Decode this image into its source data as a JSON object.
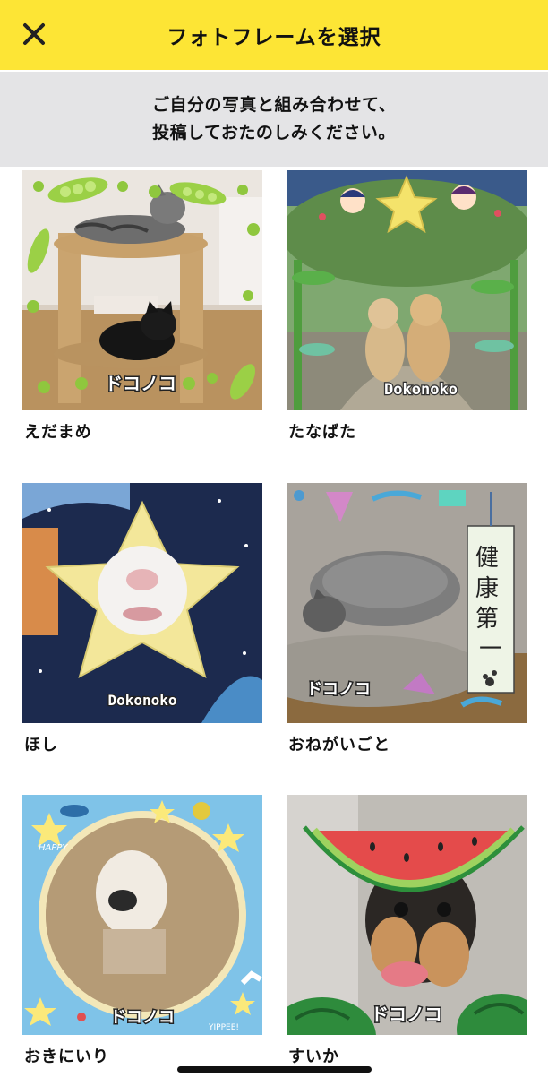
{
  "header": {
    "title": "フォトフレームを選択",
    "close_icon": "close-icon"
  },
  "banner": {
    "line1": "ご自分の写真と組み合わせて、",
    "line2": "投稿しておたのしみください。"
  },
  "frames": [
    {
      "label": "えだまめ",
      "stamp": "ドコノコ"
    },
    {
      "label": "たなばた",
      "stamp": "Dokonoko"
    },
    {
      "label": "ほし",
      "stamp": "Dokonoko"
    },
    {
      "label": "おねがいごと",
      "stamp": "ドコノコ",
      "tag": "健康第一"
    },
    {
      "label": "おきにいり",
      "stamp": "ドコノコ",
      "small_texts": [
        "HAPPY",
        "YIPPEE!"
      ]
    },
    {
      "label": "すいか",
      "stamp": "ドコノコ"
    }
  ],
  "colors": {
    "header": "#fde535",
    "banner": "#e4e4e6",
    "text": "#111111"
  }
}
